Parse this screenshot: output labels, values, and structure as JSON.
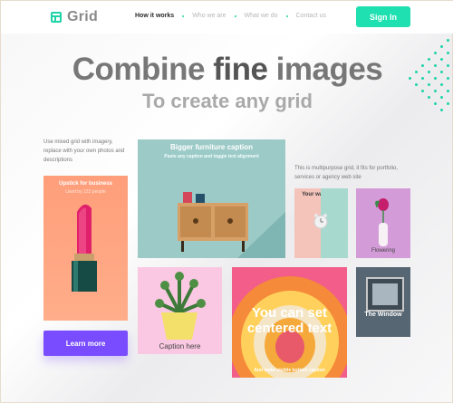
{
  "header": {
    "logo_text": "Grid",
    "nav": [
      "How it works",
      "Who we are",
      "What we do",
      "Contact us"
    ],
    "signin_label": "Sign In"
  },
  "hero": {
    "title_pre": "Combine",
    "title_highlight": "fine",
    "title_post": "images",
    "subtitle": "To create any grid"
  },
  "intro_left": "Use mixed grid with imagery, replace with your own photos and descriptions",
  "intro_right": "This is multipurpose grid, it fits for portfolio, services or agency web site",
  "tiles": {
    "lipstick": {
      "title": "Upstick for business",
      "subtitle": "Used by 123 people"
    },
    "furniture": {
      "title": "Bigger furniture caption",
      "subtitle": "Paste any caption and toggle text alignment"
    },
    "wakeuper": {
      "title": "Your wakeuper"
    },
    "flowering": {
      "title": "Flowering"
    },
    "plant": {
      "title": "Caption here"
    },
    "centered": {
      "title": "You can set centered text",
      "subtitle": "And make visible bottom caption"
    },
    "window": {
      "title": "The Window"
    }
  },
  "learn_more_label": "Learn more",
  "colors": {
    "accent": "#1fe0b0",
    "button_purple": "#7a4cff"
  },
  "icons": [
    "grid-logo-icon"
  ]
}
